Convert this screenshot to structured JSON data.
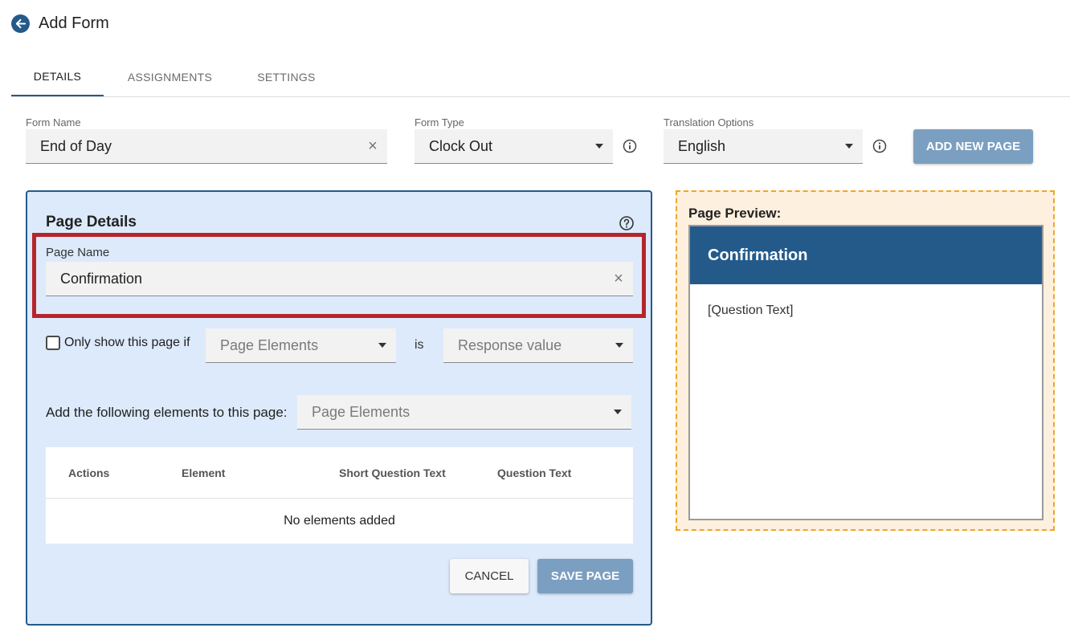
{
  "header": {
    "title": "Add Form",
    "back_icon": "arrow-left-icon"
  },
  "tabs": [
    {
      "label": "DETAILS",
      "active": true
    },
    {
      "label": "ASSIGNMENTS",
      "active": false
    },
    {
      "label": "SETTINGS",
      "active": false
    }
  ],
  "form": {
    "name_label": "Form Name",
    "name_value": "End of Day",
    "type_label": "Form Type",
    "type_value": "Clock Out",
    "translation_label": "Translation Options",
    "translation_value": "English",
    "add_page_label": "ADD NEW PAGE"
  },
  "page_details": {
    "title": "Page Details",
    "page_name_label": "Page Name",
    "page_name_value": "Confirmation",
    "only_show_label": "Only show this page if",
    "condition_element_placeholder": "Page Elements",
    "is_label": "is",
    "condition_value_placeholder": "Response value",
    "add_elements_label": "Add the following elements to this page:",
    "add_elements_placeholder": "Page Elements",
    "table": {
      "columns": [
        "Actions",
        "Element",
        "Short Question Text",
        "Question Text"
      ],
      "empty_text": "No elements added"
    },
    "cancel_label": "CANCEL",
    "save_label": "SAVE PAGE"
  },
  "preview": {
    "title": "Page Preview:",
    "page_title": "Confirmation",
    "question_text": "[Question Text]"
  },
  "colors": {
    "primary": "#245a8a",
    "button_disabled": "#7b9fc1",
    "panel_bg": "#ddeafc",
    "preview_bg": "#fdf0df",
    "preview_border": "#f0a524",
    "highlight": "#b5262b"
  }
}
